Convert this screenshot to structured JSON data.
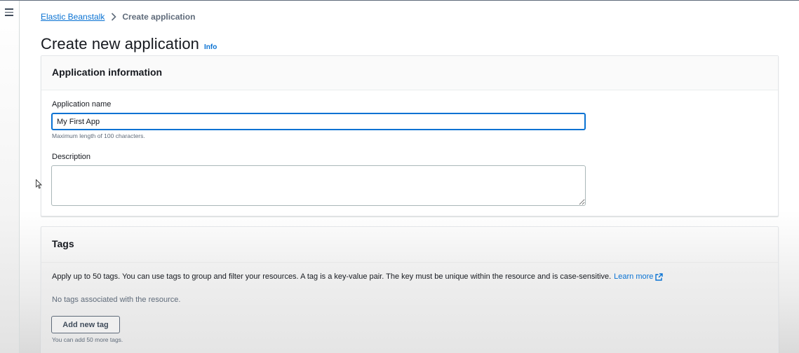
{
  "breadcrumb": {
    "items": [
      "Elastic Beanstalk",
      "Create application"
    ]
  },
  "header": {
    "title": "Create new application",
    "info": "Info"
  },
  "application_info": {
    "heading": "Application information",
    "name_label": "Application name",
    "name_value": "My First App",
    "name_hint": "Maximum length of 100 characters.",
    "description_label": "Description",
    "description_value": ""
  },
  "tags": {
    "heading": "Tags",
    "description": "Apply up to 50 tags. You can use tags to group and filter your resources. A tag is a key-value pair. The key must be unique within the resource and is case-sensitive.",
    "learn_more": "Learn more",
    "empty_text": "No tags associated with the resource.",
    "add_button": "Add new tag",
    "hint": "You can add 50 more tags."
  },
  "icons": {
    "menu": "hamburger-menu-icon",
    "breadcrumb_separator": "chevron-right-icon",
    "external_link": "external-link-icon",
    "cursor": "mouse-pointer-icon"
  },
  "colors": {
    "link": "#0972d3",
    "text": "#16191f",
    "secondary_text": "#5f6b7a",
    "focus_border": "#0972d3"
  }
}
